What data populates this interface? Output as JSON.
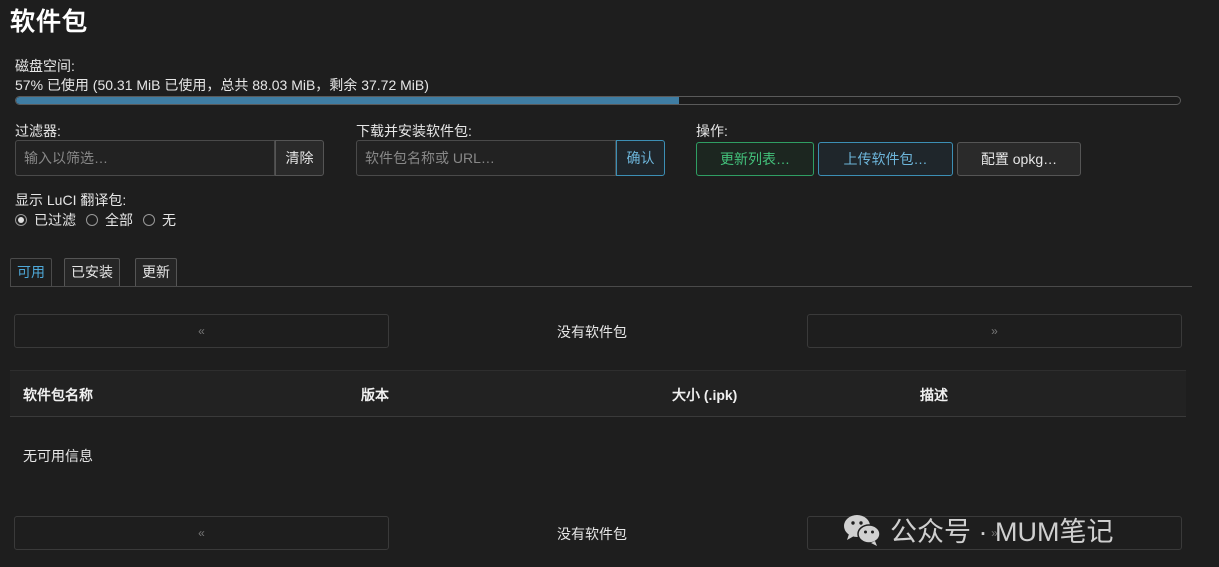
{
  "page": {
    "title": "软件包"
  },
  "disk": {
    "label": "磁盘空间:",
    "usage_text": "57% 已使用 (50.31 MiB 已使用，总共 88.03 MiB，剩余 37.72 MiB)",
    "used_fraction": 0.57,
    "bar_color": "#3f7da3"
  },
  "filter": {
    "label": "过滤器:",
    "placeholder": "输入以筛选…",
    "clear_label": "清除"
  },
  "download": {
    "label": "下载并安装软件包:",
    "placeholder": "软件包名称或 URL…",
    "confirm_label": "确认"
  },
  "actions": {
    "label": "操作:",
    "update_lists": "更新列表…",
    "upload_package": "上传软件包…",
    "configure_opkg": "配置 opkg…"
  },
  "luci_i18n": {
    "label": "显示 LuCI 翻译包:",
    "options": [
      {
        "label": "已过滤",
        "checked": true
      },
      {
        "label": "全部",
        "checked": false
      },
      {
        "label": "无",
        "checked": false
      }
    ]
  },
  "tabs": [
    {
      "label": "可用",
      "active": true
    },
    {
      "label": "已安装",
      "active": false
    },
    {
      "label": "更新",
      "active": false
    }
  ],
  "pager": {
    "prev": "«",
    "next": "»",
    "status": "没有软件包"
  },
  "table": {
    "headers": [
      "软件包名称",
      "版本",
      "大小 (.ipk)",
      "描述"
    ],
    "empty_text": "无可用信息"
  },
  "watermark": {
    "text": "公众号 · MUM笔记",
    "icon": "wechat-icon"
  },
  "colors": {
    "accent_blue": "#4ea8d8",
    "accent_green": "#43c17b",
    "background": "#1e1e1e"
  }
}
